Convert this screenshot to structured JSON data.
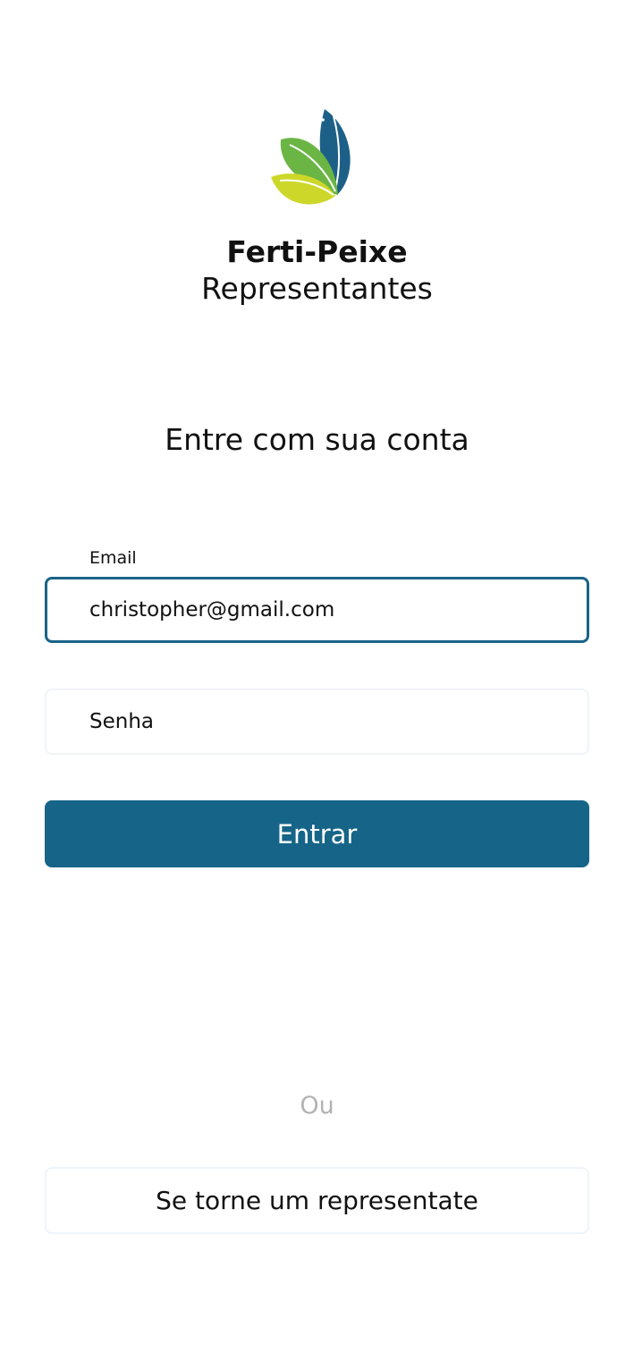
{
  "brand": {
    "logo_icon": "leaf-fish-logo-icon",
    "title": "Ferti-Peixe",
    "subtitle": "Representantes"
  },
  "login": {
    "heading": "Entre com sua conta",
    "email": {
      "label": "Email",
      "value": "christopher@gmail.com"
    },
    "password": {
      "placeholder": "Senha"
    },
    "submit_label": "Entrar"
  },
  "divider": "Ou",
  "register_label": "Se torne um representate",
  "colors": {
    "primary": "#166589",
    "leaf_green": "#6bb545",
    "leaf_yellow": "#cdd72a",
    "muted_text": "#b3b3b3",
    "light_border": "#eef4fa"
  }
}
